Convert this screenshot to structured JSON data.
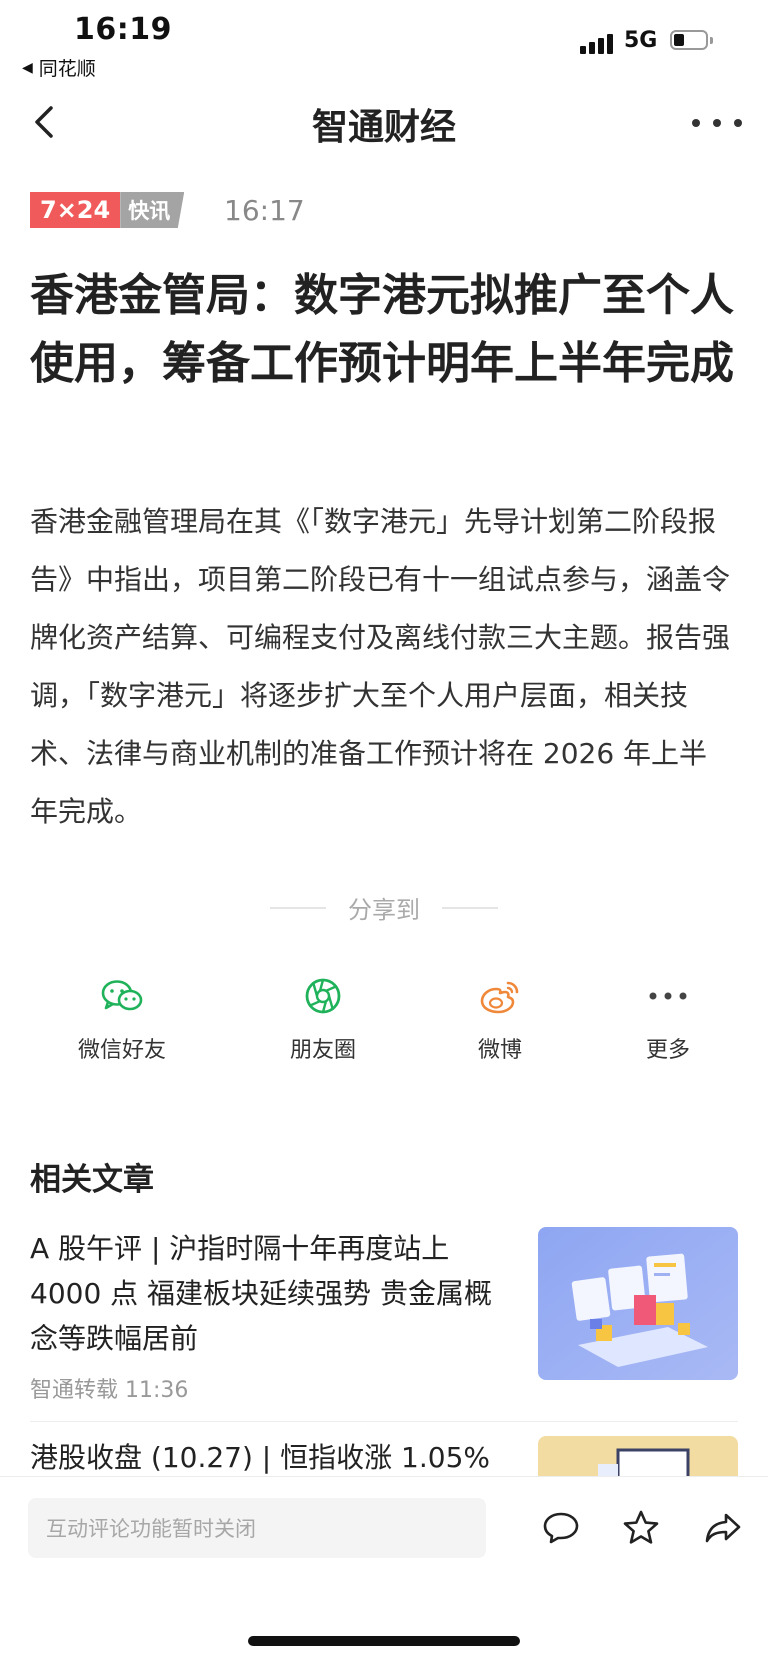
{
  "status_bar": {
    "time": "16:19",
    "back_app": "同花顺",
    "network": "5G"
  },
  "nav": {
    "title": "智通财经"
  },
  "article": {
    "badge_left": "7×24",
    "badge_right": "快讯",
    "time": "16:17",
    "headline": "香港金管局：数字港元拟推广至个人使用，筹备工作预计明年上半年完成",
    "body": "香港金融管理局在其《「数字港元」先导计划第二阶段报告》中指出，项目第二阶段已有十一组试点参与，涵盖令牌化资产结算、可编程支付及离线付款三大主题。报告强调，「数字港元」将逐步扩大至个人用户层面，相关技术、法律与商业机制的准备工作预计将在 2026 年上半年完成。"
  },
  "share": {
    "label": "分享到",
    "items": [
      {
        "label": "微信好友",
        "icon": "wechat-icon",
        "color": "#1fb25a"
      },
      {
        "label": "朋友圈",
        "icon": "moments-icon",
        "color": "#1fb25a"
      },
      {
        "label": "微博",
        "icon": "weibo-icon",
        "color": "#f0883a"
      },
      {
        "label": "更多",
        "icon": "more-icon",
        "color": "#444444"
      }
    ]
  },
  "related": {
    "title": "相关文章",
    "items": [
      {
        "title": "A 股午评 | 沪指时隔十年再度站上 4000 点 福建板块延续强势 贵金属概念等跌幅居前",
        "source": "智通转载",
        "time": "11:36"
      },
      {
        "title": "港股收盘 (10.27) | 恒指收涨 1.05%"
      }
    ]
  },
  "bottom_bar": {
    "comment_placeholder": "互动评论功能暂时关闭"
  },
  "colors": {
    "badge_red": "#f05a5a",
    "badge_gray": "#a4a4a4",
    "share_green": "#1fb25a",
    "share_orange": "#f0883a"
  }
}
